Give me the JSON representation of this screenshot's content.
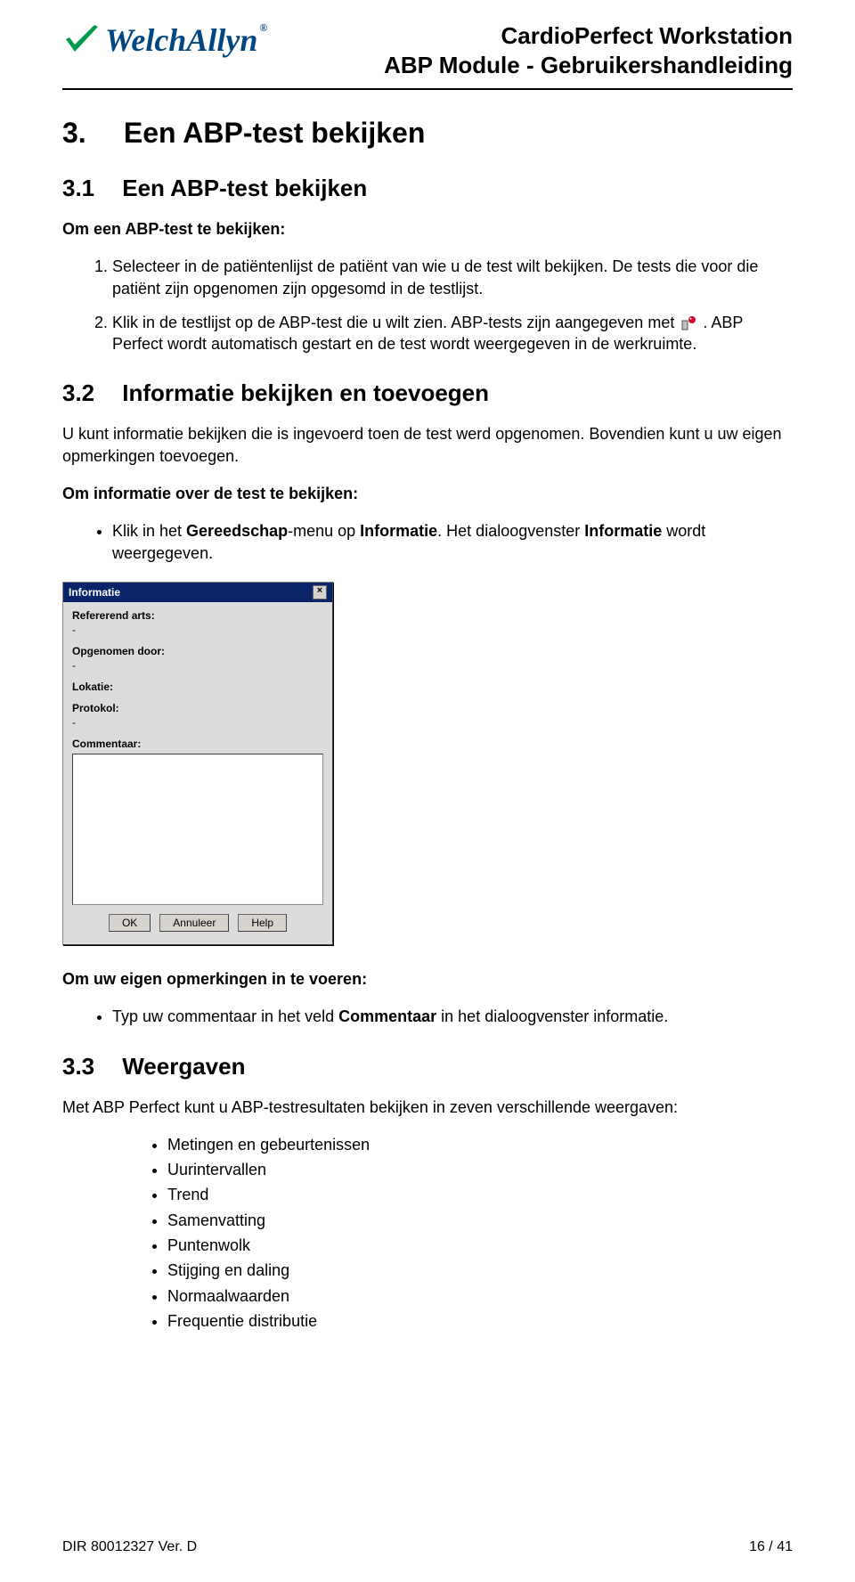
{
  "header": {
    "logo_text": "WelchAllyn",
    "title1": "CardioPerfect Workstation",
    "title2": "ABP Module - Gebruikershandleiding"
  },
  "section3": {
    "num": "3.",
    "title": "Een ABP-test bekijken"
  },
  "section3_1": {
    "num": "3.1",
    "title": "Een ABP-test bekijken",
    "intro_bold": "Om een ABP-test te bekijken:",
    "step1": "Selecteer in de patiëntenlijst de patiënt van wie u de test wilt bekijken. De tests die voor die patiënt zijn opgenomen zijn opgesomd in de testlijst.",
    "step2a": "Klik in de testlijst op de ABP-test die u wilt zien. ABP-tests zijn aangegeven met ",
    "step2b": ". ABP Perfect wordt automatisch gestart en de test wordt weergegeven in de werkruimte."
  },
  "section3_2": {
    "num": "3.2",
    "title": "Informatie bekijken en toevoegen",
    "para1": "U kunt informatie bekijken die is ingevoerd toen de test werd opgenomen. Bovendien kunt u uw eigen opmerkingen toevoegen.",
    "intro_bold": "Om informatie over de test te bekijken:",
    "bullet_a": "Klik in het ",
    "bullet_b": "Gereedschap",
    "bullet_c": "-menu op ",
    "bullet_d": "Informatie",
    "bullet_e": ". Het dialoogvenster ",
    "bullet_f": "Informatie",
    "bullet_g": " wordt weergegeven."
  },
  "dialog": {
    "title": "Informatie",
    "fields": {
      "referring_label": "Refererend arts:",
      "referring_value": "-",
      "recorded_label": "Opgenomen door:",
      "recorded_value": "-",
      "location_label": "Lokatie:",
      "protocol_label": "Protokol:",
      "protocol_value": "-",
      "comment_label": "Commentaar:"
    },
    "buttons": {
      "ok": "OK",
      "cancel": "Annuleer",
      "help": "Help"
    }
  },
  "section3_2b": {
    "intro_bold": "Om uw eigen opmerkingen in te voeren:",
    "bullet_a": "Typ uw commentaar in het veld ",
    "bullet_b": "Commentaar",
    "bullet_c": " in het dialoogvenster informatie."
  },
  "section3_3": {
    "num": "3.3",
    "title": "Weergaven",
    "para": "Met ABP Perfect kunt u ABP-testresultaten bekijken in zeven verschillende weergaven:",
    "items": [
      "Metingen en gebeurtenissen",
      "Uurintervallen",
      "Trend",
      "Samenvatting",
      "Puntenwolk",
      "Stijging en daling",
      "Normaalwaarden",
      "Frequentie distributie"
    ]
  },
  "footer": {
    "left": "DIR 80012327 Ver. D",
    "right": "16 / 41"
  }
}
